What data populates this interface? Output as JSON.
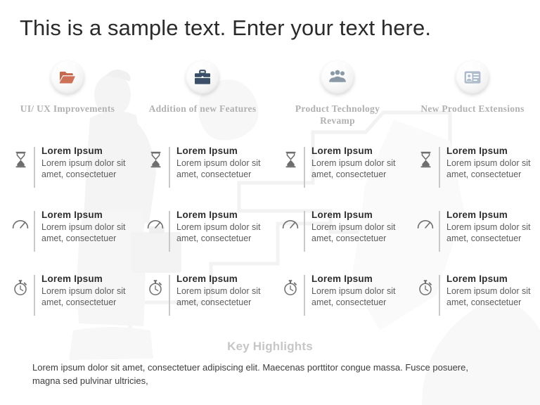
{
  "slide": {
    "title": "This is a sample text. Enter your text here."
  },
  "columns": [
    {
      "label": "UI/ UX Improvements",
      "icon": "folder-open-icon",
      "icon_color": "#c4684f"
    },
    {
      "label": "Addition  of new Features",
      "icon": "briefcase-icon",
      "icon_color": "#3b4f68"
    },
    {
      "label": "Product Technology Revamp",
      "icon": "people-group-icon",
      "icon_color": "#8b98a6"
    },
    {
      "label": "New Product Extensions",
      "icon": "id-badge-icon",
      "icon_color": "#aebccb"
    }
  ],
  "rows": [
    {
      "icon": "hourglass-icon",
      "cells": [
        {
          "title": "Lorem Ipsum",
          "description": "Lorem ipsum dolor sit amet, consectetuer"
        },
        {
          "title": "Lorem Ipsum",
          "description": "Lorem ipsum dolor sit amet, consectetuer"
        },
        {
          "title": "Lorem Ipsum",
          "description": "Lorem ipsum dolor sit amet, consectetuer"
        },
        {
          "title": "Lorem Ipsum",
          "description": "Lorem ipsum dolor sit amet, consectetuer"
        }
      ]
    },
    {
      "icon": "gauge-icon",
      "cells": [
        {
          "title": "Lorem Ipsum",
          "description": "Lorem ipsum dolor sit amet, consectetuer"
        },
        {
          "title": "Lorem Ipsum",
          "description": "Lorem ipsum dolor sit amet, consectetuer"
        },
        {
          "title": "Lorem Ipsum",
          "description": "Lorem ipsum dolor sit amet, consectetuer"
        },
        {
          "title": "Lorem Ipsum",
          "description": "Lorem ipsum dolor sit amet, consectetuer"
        }
      ]
    },
    {
      "icon": "stopwatch-icon",
      "cells": [
        {
          "title": "Lorem Ipsum",
          "description": "Lorem ipsum dolor sit amet, consectetuer"
        },
        {
          "title": "Lorem Ipsum",
          "description": "Lorem ipsum dolor sit amet, consectetuer"
        },
        {
          "title": "Lorem Ipsum",
          "description": "Lorem ipsum dolor sit amet, consectetuer"
        },
        {
          "title": "Lorem Ipsum",
          "description": "Lorem ipsum dolor sit amet, consectetuer"
        }
      ]
    }
  ],
  "footer": {
    "heading": "Key Highlights",
    "body": "Lorem ipsum dolor sit amet, consectetuer adipiscing elit. Maecenas porttitor congue massa. Fusce posuere, magna sed pulvinar ultricies,"
  },
  "theme": {
    "title_color": "#2b2b2b",
    "label_color": "#b1b1b1",
    "cell_title_color": "#2e2e2e",
    "cell_desc_color": "#5d5d5d",
    "footer_heading_color": "#c6c6c6",
    "divider_color": "#c9c9c9",
    "background_color": "#ffffff"
  }
}
